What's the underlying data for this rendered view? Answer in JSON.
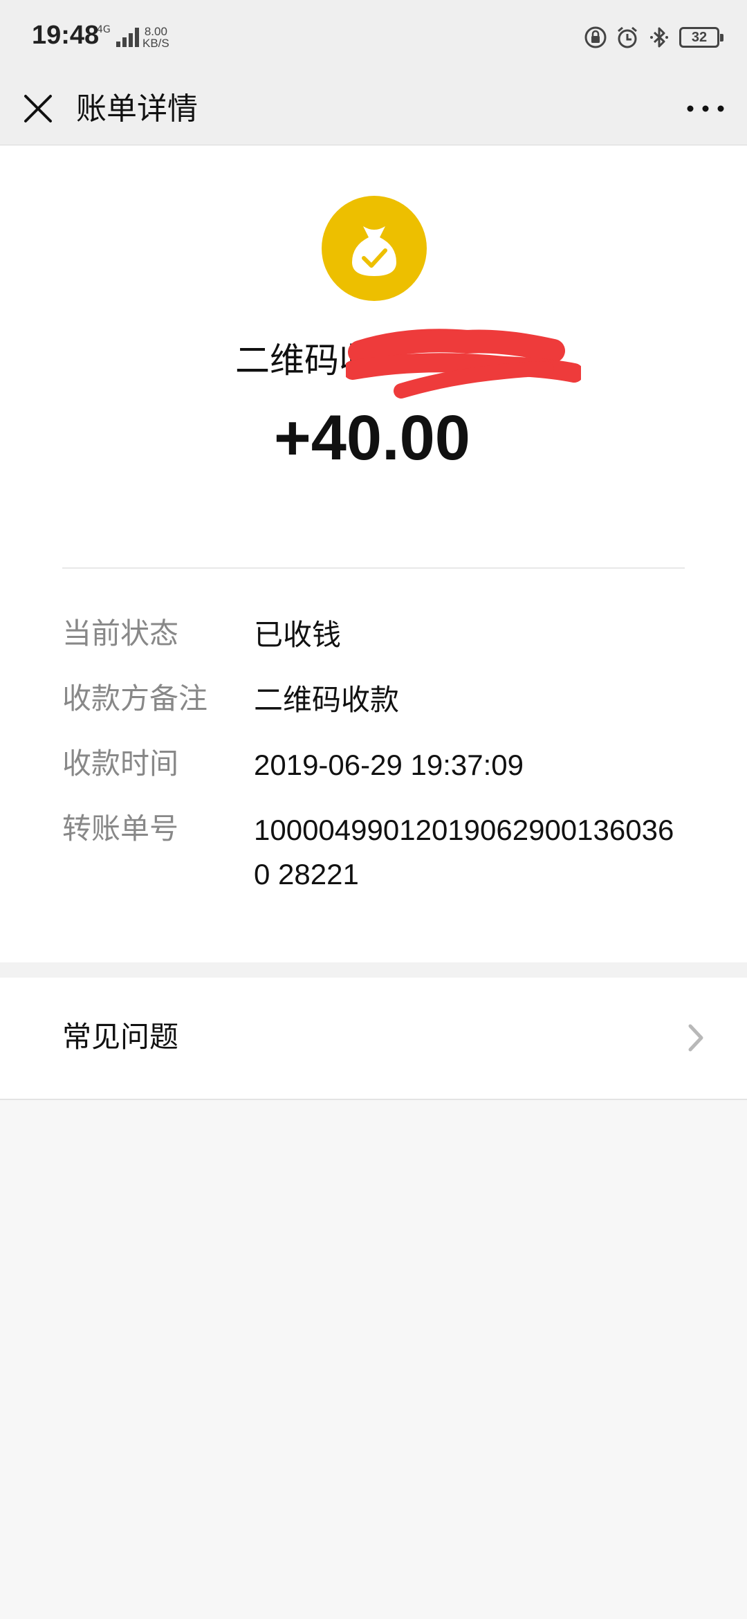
{
  "status_bar": {
    "time": "19:48",
    "network": "4G",
    "speed_value": "8.00",
    "speed_unit": "KB/S",
    "battery": "32"
  },
  "nav": {
    "title": "账单详情",
    "close_icon": "close-icon",
    "more_icon": "more-icon"
  },
  "transaction": {
    "icon": "money-bag-check-icon",
    "icon_color": "#EDBF00",
    "payee": "二维码收",
    "amount": "+40.00"
  },
  "details": [
    {
      "label": "当前状态",
      "value": "已收钱"
    },
    {
      "label": "收款方备注",
      "value": "二维码收款"
    },
    {
      "label": "收款时间",
      "value": "2019-06-29 19:37:09"
    },
    {
      "label": "转账单号",
      "value": "100004990120190629001360360 28221"
    }
  ],
  "faq": {
    "label": "常见问题",
    "chevron_icon": "chevron-right-icon"
  },
  "colors": {
    "redaction": "#EE3B3B",
    "background": "#F7F7F7"
  }
}
